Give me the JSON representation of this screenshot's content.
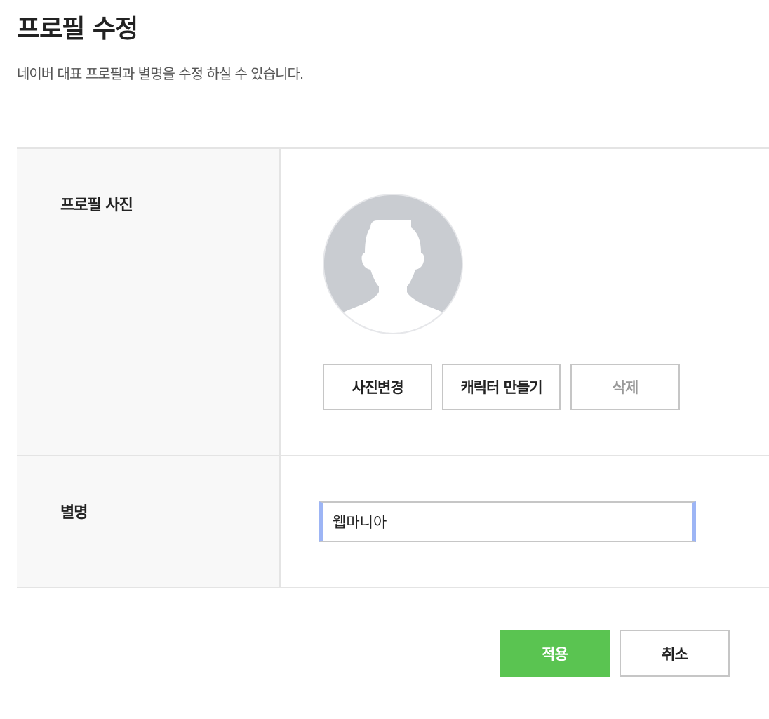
{
  "header": {
    "title": "프로필 수정",
    "subtitle": "네이버 대표 프로필과 별명을 수정 하실 수 있습니다."
  },
  "photo_section": {
    "label": "프로필 사진",
    "avatar_icon": "default-user-silhouette-icon",
    "buttons": {
      "change_photo": "사진변경",
      "make_character": "캐릭터 만들기",
      "delete": "삭제"
    }
  },
  "nickname_section": {
    "label": "별명",
    "value": "웹마니아"
  },
  "actions": {
    "apply": "적용",
    "cancel": "취소"
  },
  "colors": {
    "apply_button": "#5ac451",
    "focus_border": "#9db5f5",
    "label_background": "#f8f8f8",
    "avatar_background": "#c9ccd1"
  }
}
